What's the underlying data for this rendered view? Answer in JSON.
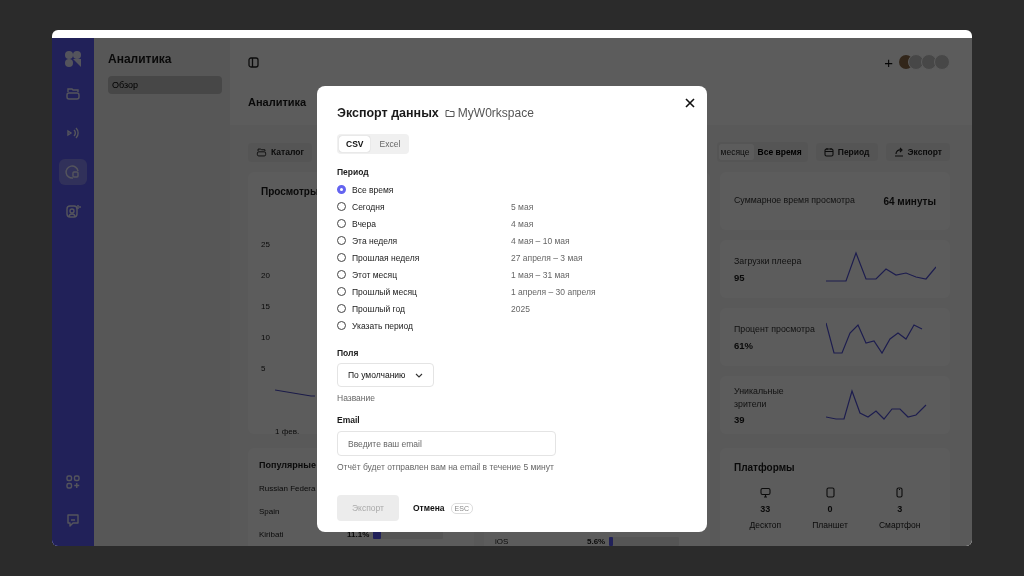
{
  "rail": {
    "items": [
      {
        "selected": false
      },
      {
        "selected": false
      },
      {
        "selected": true
      },
      {
        "selected": false
      }
    ]
  },
  "sidebar": {
    "title": "Аналитика",
    "items": [
      {
        "label": "Обзор",
        "selected": true
      }
    ]
  },
  "topbar": {
    "add_button": "+"
  },
  "page": {
    "title": "Аналитика",
    "catalog_button": "Каталог",
    "range": [
      {
        "label": "месяце",
        "selected": true
      },
      {
        "label": "Все время",
        "selected": false
      }
    ],
    "period_button": "Период",
    "export_button": "Экспорт"
  },
  "views_card": {
    "title": "Просмотры",
    "y_ticks": [
      "25",
      "20",
      "15",
      "10",
      "5"
    ],
    "x_labels": [
      "1 фев."
    ]
  },
  "popular_card": {
    "title": "Популярные",
    "rows": [
      {
        "name": "Russian Federa"
      },
      {
        "name": "Spain"
      },
      {
        "name": "Kiribati",
        "share": "11.1%",
        "level": 0.111
      }
    ]
  },
  "second_card": {
    "rows": [
      {
        "name": "iOS",
        "share": "5.6%",
        "level": 0.056
      }
    ]
  },
  "stats": [
    {
      "kind": "total",
      "label": "Суммарное время просмотра",
      "value": "64 минуты"
    },
    {
      "kind": "spark",
      "label": "Загрузки плеера",
      "value": "95"
    },
    {
      "kind": "spark",
      "label": "Процент просмотра",
      "value": "61%"
    },
    {
      "kind": "spark",
      "label": "Уникальные зрители",
      "value": "39"
    }
  ],
  "platforms": {
    "title": "Платформы",
    "items": [
      {
        "count": "33",
        "label": "Десктоп"
      },
      {
        "count": "0",
        "label": "Планшет"
      },
      {
        "count": "3",
        "label": "Смартфон"
      }
    ]
  },
  "modal": {
    "title": "Экспорт данных",
    "workspace": "MyW0rkspace",
    "formats": [
      {
        "label": "CSV",
        "selected": true
      },
      {
        "label": "Excel",
        "selected": false
      }
    ],
    "period_label": "Период",
    "periods": [
      {
        "label": "Все время",
        "selected": true
      },
      {
        "label": "Сегодня",
        "dates": "5 мая",
        "selected": false
      },
      {
        "label": "Вчера",
        "dates": "4 мая",
        "selected": false
      },
      {
        "label": "Эта неделя",
        "dates": "4 мая – 10 мая",
        "selected": false
      },
      {
        "label": "Прошлая неделя",
        "dates": "27 апреля – 3 мая",
        "selected": false
      },
      {
        "label": "Этот месяц",
        "dates": "1 мая – 31 мая",
        "selected": false
      },
      {
        "label": "Прошлый месяц",
        "dates": "1 апреля – 30 апреля",
        "selected": false
      },
      {
        "label": "Прошлый год",
        "dates": "2025",
        "selected": false
      },
      {
        "label": "Указать период",
        "selected": false
      }
    ],
    "fields_label": "Поля",
    "fields_value": "По умолчанию",
    "fields_hint": "Название",
    "email_label": "Email",
    "email_placeholder": "Введите ваш email",
    "email_hint": "Отчёт будет отправлен вам на email в течение 5 минут",
    "export_button": {
      "label": "Экспорт",
      "disabled": true
    },
    "cancel_button": "Отмена",
    "cancel_key": "ESC"
  }
}
